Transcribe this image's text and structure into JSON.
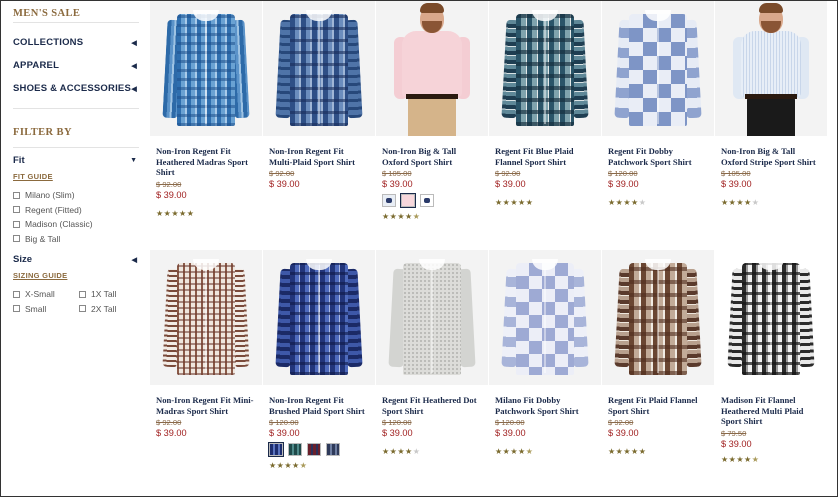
{
  "sidebar": {
    "title": "MEN'S SALE",
    "nav": [
      {
        "label": "COLLECTIONS"
      },
      {
        "label": "APPAREL"
      },
      {
        "label": "SHOES & ACCESSORIES"
      }
    ],
    "filter_title": "FILTER BY",
    "fit": {
      "label": "Fit",
      "guide": "FIT GUIDE",
      "options": [
        "Milano (Slim)",
        "Regent (Fitted)",
        "Madison (Classic)",
        "Big & Tall"
      ]
    },
    "size": {
      "label": "Size",
      "guide": "SIZING GUIDE",
      "options": [
        "X-Small",
        "1X Tall",
        "Small",
        "2X Tall"
      ]
    }
  },
  "colors": {
    "gold": "#8b6a3e",
    "navy": "#1b2a4a",
    "sale_red": "#a12222",
    "star": "#7a6a2e"
  },
  "products": [
    {
      "name": "Non-Iron Regent Fit Heathered Madras Sport Shirt",
      "orig": "$ 92.00",
      "sale": "$ 39.00",
      "rating": 5,
      "image": "blue-madras-plaid-shirt"
    },
    {
      "name": "Non-Iron Regent Fit Multi-Plaid Sport Shirt",
      "orig": "$ 92.00",
      "sale": "$ 39.00",
      "rating": 0,
      "image": "blue-multi-plaid-shirt"
    },
    {
      "name": "Non-Iron Big & Tall Oxford Sport Shirt",
      "orig": "$ 105.00",
      "sale": "$ 39.00",
      "rating": 4.5,
      "image": "model-pink-oxford-shirt"
    },
    {
      "name": "Regent Fit Blue Plaid Flannel Sport Shirt",
      "orig": "$ 92.00",
      "sale": "$ 39.00",
      "rating": 5,
      "image": "teal-plaid-flannel-shirt"
    },
    {
      "name": "Regent Fit Dobby Patchwork Sport Shirt",
      "orig": "$ 120.00",
      "sale": "$ 39.00",
      "rating": 4,
      "image": "blue-patchwork-shirt"
    },
    {
      "name": "Non-Iron Big & Tall Oxford Stripe Sport Shirt",
      "orig": "$ 105.00",
      "sale": "$ 39.00",
      "rating": 4,
      "image": "model-blue-stripe-shirt"
    },
    {
      "name": "Non-Iron Regent Fit Mini-Madras Sport Shirt",
      "orig": "$ 92.00",
      "sale": "$ 39.00",
      "rating": 0,
      "image": "brown-mini-madras-shirt"
    },
    {
      "name": "Non-Iron Regent Fit Brushed Plaid Sport Shirt",
      "orig": "$ 120.00",
      "sale": "$ 39.00",
      "rating": 4.5,
      "image": "navy-brushed-plaid-shirt"
    },
    {
      "name": "Regent Fit Heathered Dot Sport Shirt",
      "orig": "$ 120.00",
      "sale": "$ 39.00",
      "rating": 4,
      "image": "grey-heathered-dot-shirt"
    },
    {
      "name": "Milano Fit Dobby Patchwork Sport Shirt",
      "orig": "$ 120.00",
      "sale": "$ 39.00",
      "rating": 4.5,
      "image": "lavender-patchwork-shirt"
    },
    {
      "name": "Regent Fit Plaid Flannel Sport Shirt",
      "orig": "$ 92.00",
      "sale": "$ 39.00",
      "rating": 5,
      "image": "brown-plaid-flannel-shirt"
    },
    {
      "name": "Madison Fit Flannel Heathered Multi Plaid Sport Shirt",
      "orig": "$ 79.50",
      "sale": "$ 39.00",
      "rating": 4.5,
      "image": "black-white-plaid-shirt"
    }
  ]
}
